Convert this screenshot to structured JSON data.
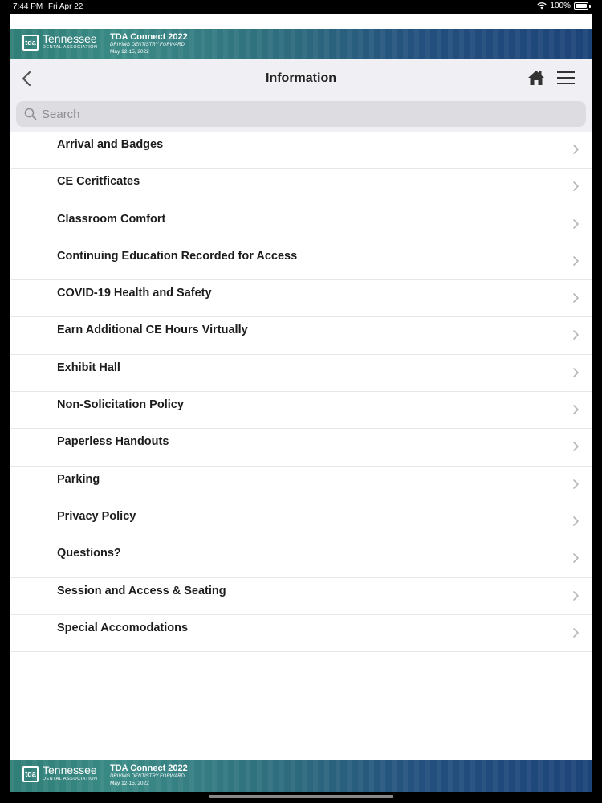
{
  "status_bar": {
    "time": "7:44 PM",
    "date": "Fri Apr 22",
    "battery": "100%"
  },
  "banner": {
    "logo_text": "tda",
    "org_name": "Tennessee",
    "org_sub": "DENTAL ASSOCIATION",
    "event_title": "TDA Connect 2022",
    "event_tagline": "DRIVING DENTISTRY FORWARD",
    "event_dates": "May 12-15, 2022"
  },
  "nav": {
    "title": "Information"
  },
  "search": {
    "placeholder": "Search",
    "value": ""
  },
  "items": [
    {
      "label": "Arrival and Badges"
    },
    {
      "label": "CE Ceritficates"
    },
    {
      "label": "Classroom Comfort"
    },
    {
      "label": "Continuing Education Recorded for Access"
    },
    {
      "label": "COVID-19 Health and Safety"
    },
    {
      "label": "Earn Additional CE Hours Virtually"
    },
    {
      "label": "Exhibit Hall"
    },
    {
      "label": "Non-Solicitation Policy"
    },
    {
      "label": "Paperless Handouts"
    },
    {
      "label": "Parking"
    },
    {
      "label": "Privacy Policy"
    },
    {
      "label": "Questions?"
    },
    {
      "label": "Session and Access & Seating"
    },
    {
      "label": "Special Accomodations"
    }
  ],
  "icons": {
    "back": "chevron-left-icon",
    "home": "home-icon",
    "menu": "hamburger-menu-icon",
    "search": "search-icon",
    "row": "chevron-right-icon"
  },
  "colors": {
    "banner_start": "#2f7e77",
    "banner_end": "#1d4479",
    "nav_bg": "#efeff4"
  }
}
